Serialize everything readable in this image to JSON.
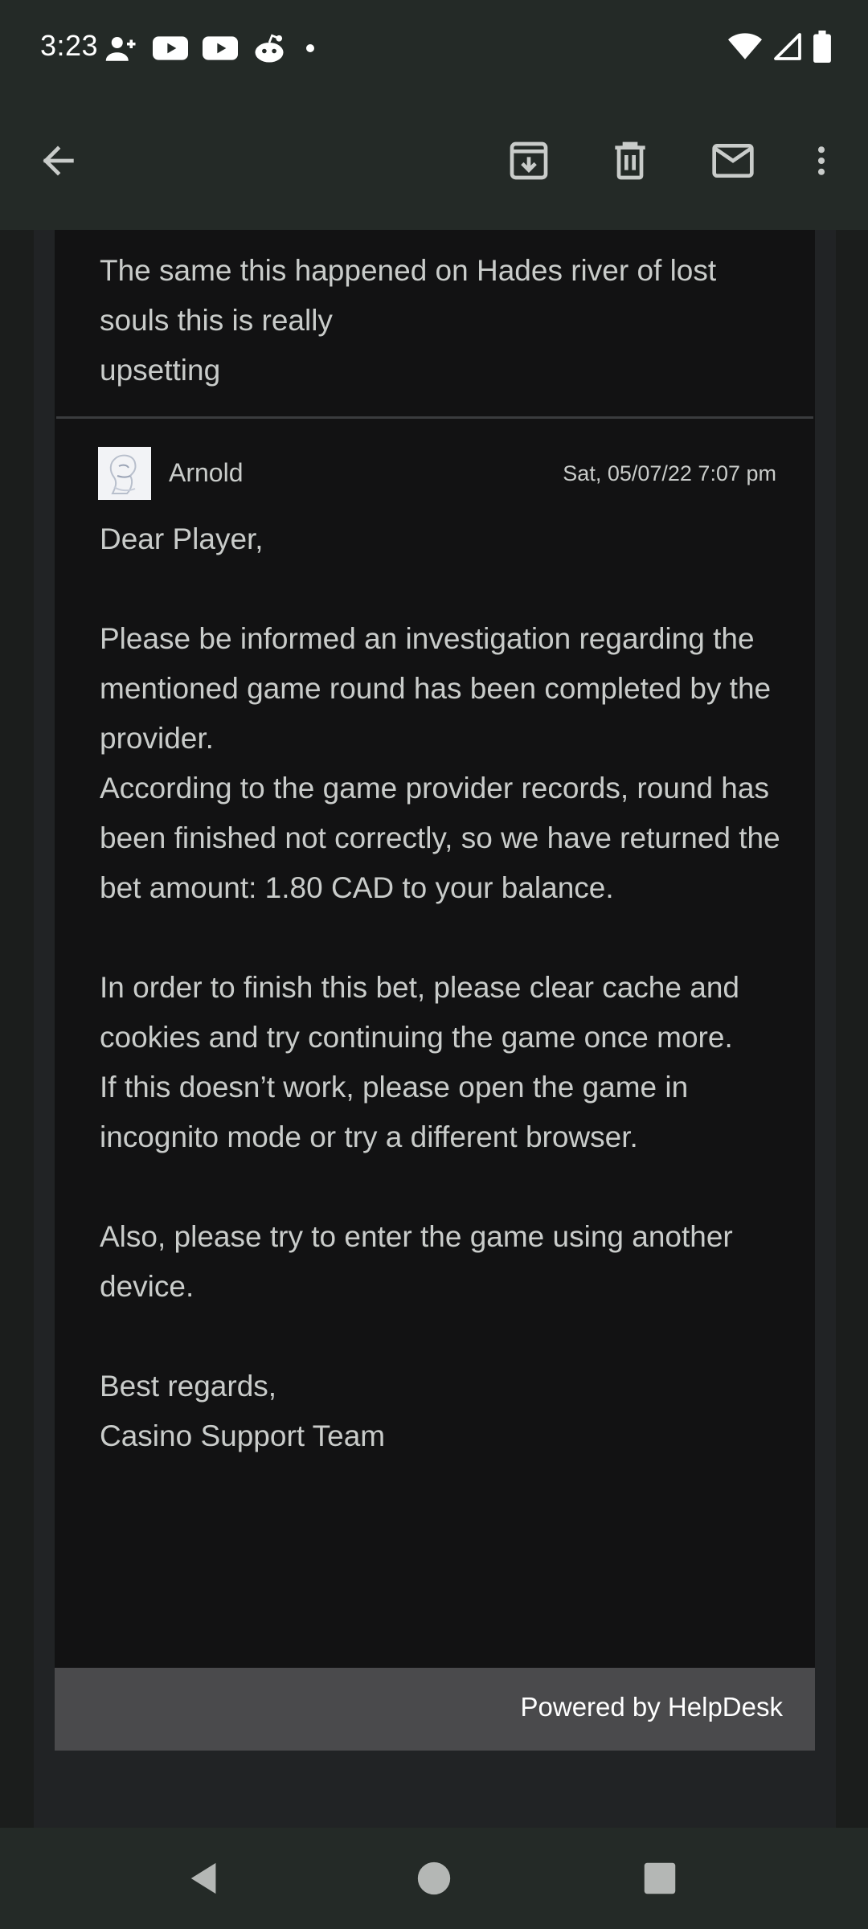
{
  "status_bar": {
    "time": "3:23",
    "notification_icons": [
      "person-add-icon",
      "youtube-icon",
      "youtube-icon",
      "reddit-icon",
      "dot-icon"
    ],
    "system_icons": [
      "wifi-icon",
      "cellular-signal-icon",
      "battery-icon"
    ]
  },
  "toolbar": {
    "buttons": [
      "back-arrow-icon",
      "archive-icon",
      "delete-icon",
      "mark-unread-icon",
      "more-vert-icon"
    ]
  },
  "email": {
    "previous_message": "The same this happened on Hades river of lost\nsouls this is really\nupsetting",
    "reply": {
      "sender": "Arnold",
      "date": "Sat, 05/07/22 7:07 pm",
      "greeting": "Dear Player,",
      "paragraph1": "Please be informed an investigation regarding the mentioned game round has been completed by the provider.",
      "paragraph2": "According to the game provider records, round has been finished not correctly, so we have returned the bet amount: 1.80 CAD to your balance.",
      "paragraph3": "In order to finish this bet, please clear cache and cookies and try continuing the game once more.",
      "paragraph4": "If this doesn’t work, please open the game in incognito mode or try a different browser.",
      "paragraph5": "Also, please try to enter the game using another device.",
      "closing": "Best regards,",
      "signature": "Casino Support Team"
    },
    "footer": "Powered by HelpDesk"
  },
  "nav_bar": {
    "buttons": [
      "nav-back-icon",
      "nav-home-icon",
      "nav-recents-icon"
    ]
  },
  "colors": {
    "app_bar": "#242a27",
    "card_background": "#121213",
    "body_text": "#c9ccca",
    "footer_bar": "#4a4a4c"
  }
}
